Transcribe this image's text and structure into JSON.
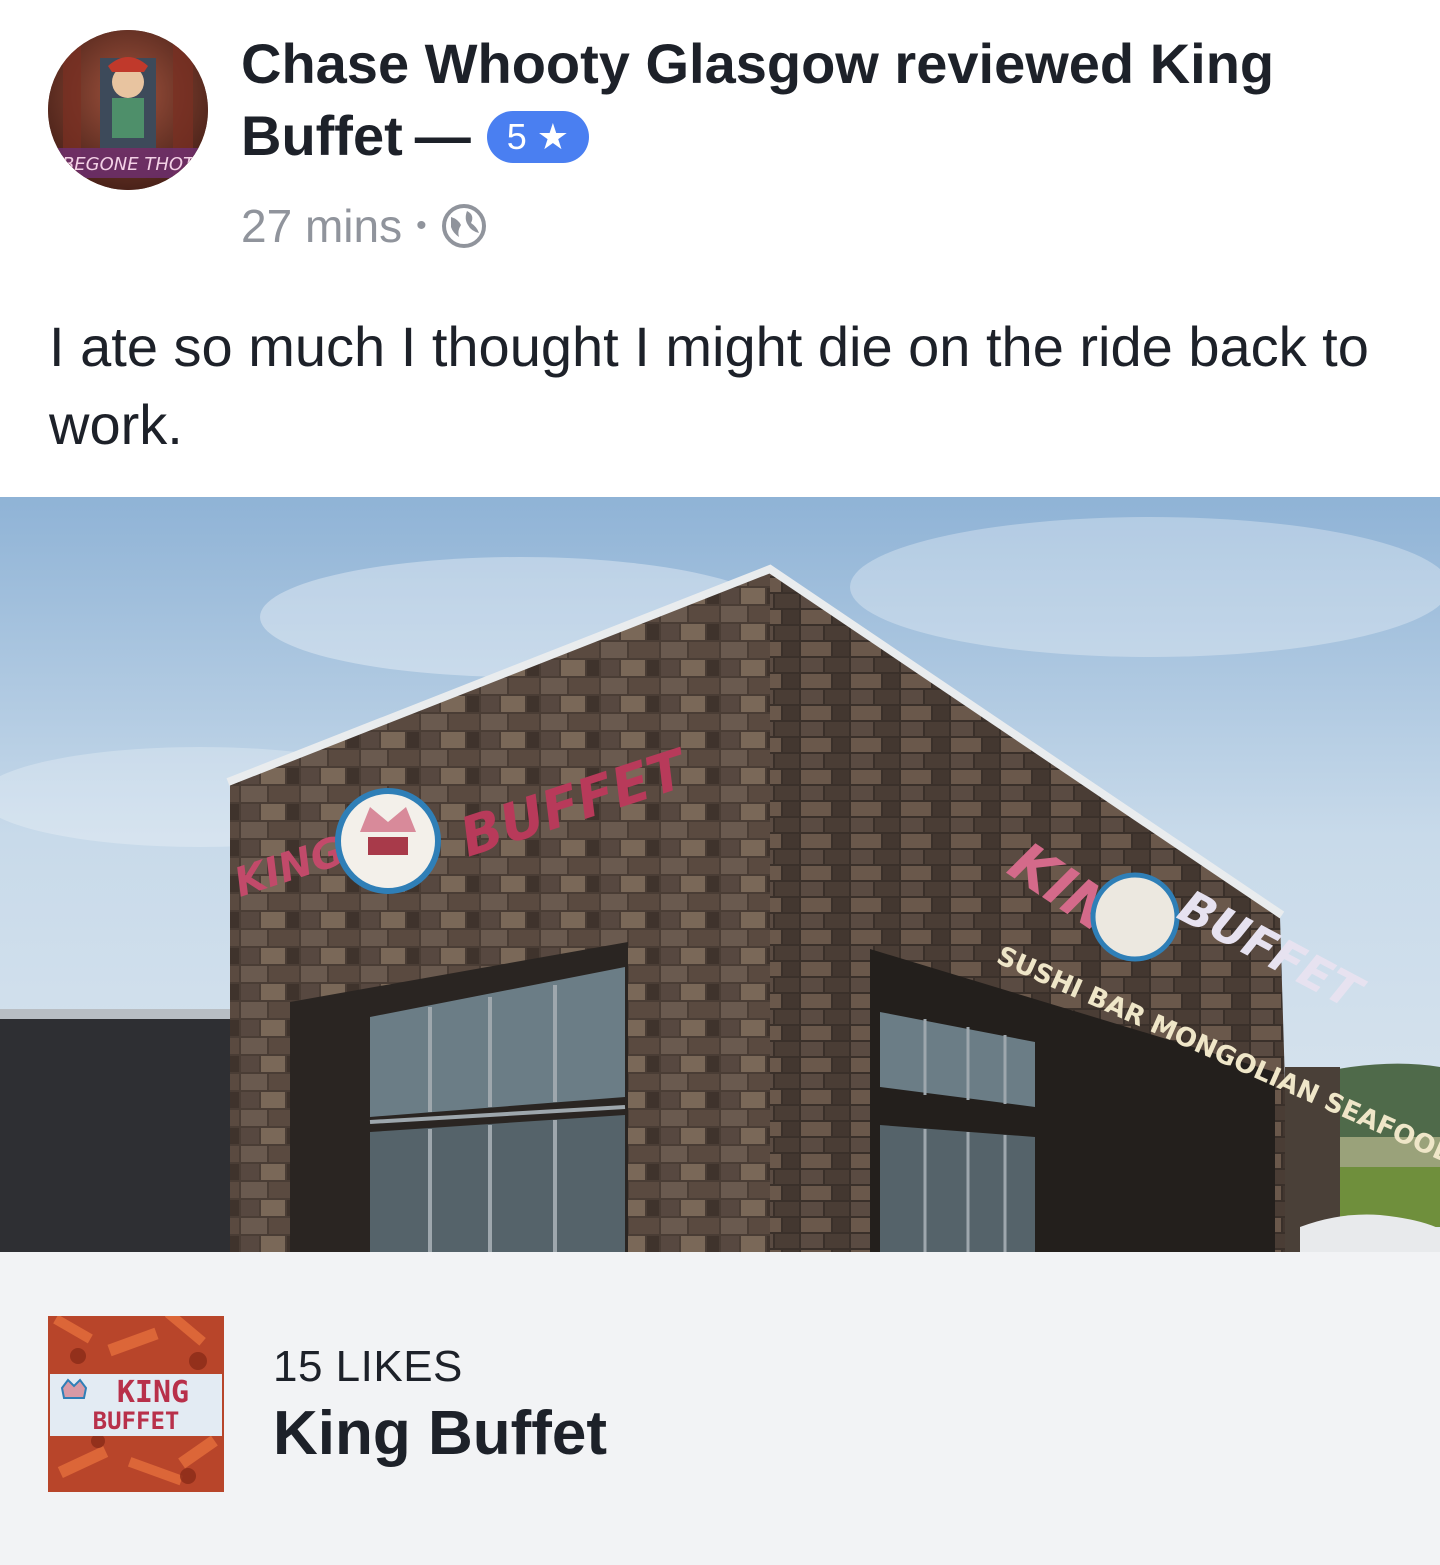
{
  "post": {
    "author": "Chase Whooty Glasgow",
    "action": "reviewed",
    "place": "King Buffet",
    "separator": "—",
    "rating": "5 ★",
    "time": "27 mins",
    "meta_separator": "•",
    "privacy_icon": "globe-icon",
    "text": "I ate so much I thought I might die on the ride back to work.",
    "avatar_caption": "BEGONE THOT"
  },
  "photo": {
    "sign_left_king": "KING",
    "sign_left_buffet": "BUFFET",
    "sign_right_king": "KING",
    "sign_right_buffet": "BUFFET",
    "sign_subtitle": "SUSHI BAR MONGOLIAN SEAFOOD"
  },
  "page_card": {
    "likes": "15 LIKES",
    "name": "King Buffet",
    "thumb_line1": "KING",
    "thumb_line2": "BUFFET"
  },
  "colors": {
    "rating_badge": "#4a7ff1",
    "meta_gray": "#90949c",
    "card_bg": "#f2f3f5",
    "text": "#1d2129"
  }
}
